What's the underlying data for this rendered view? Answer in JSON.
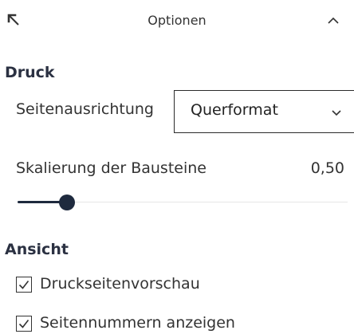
{
  "header": {
    "title": "Optionen",
    "collapse_icon": "arrow-up-left-icon",
    "toggle_icon": "chevron-up-icon"
  },
  "druck": {
    "section_title": "Druck",
    "orientation_label": "Seitenausrichtung",
    "orientation_value": "Querformat",
    "scale_label": "Skalierung der Bausteine",
    "scale_value": "0,50",
    "scale_level": 0.5
  },
  "ansicht": {
    "section_title": "Ansicht",
    "checkboxes": [
      {
        "label": "Druckseitenvorschau",
        "checked": true
      },
      {
        "label": "Seitennummern anzeigen",
        "checked": true
      }
    ]
  },
  "colors": {
    "accent": "#1e2a3e",
    "text": "#333333"
  }
}
